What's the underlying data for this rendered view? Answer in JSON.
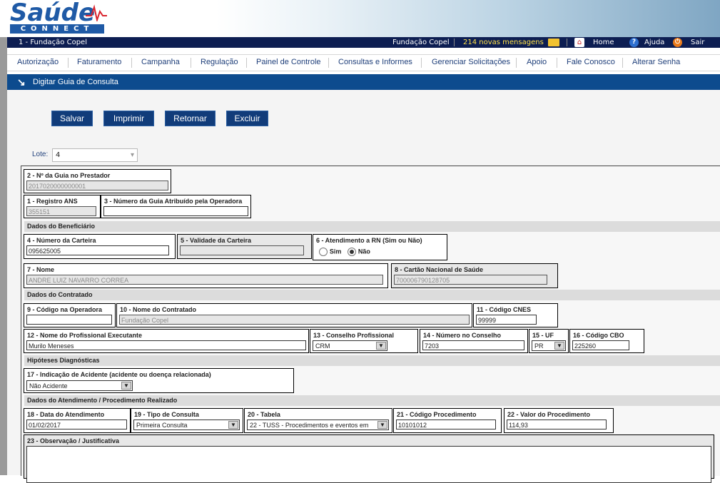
{
  "header": {
    "logo_main": "Saúde",
    "logo_sub": "CONNECT",
    "org_code": "1 - Fundação Copel",
    "org_name": "Fundação Copel",
    "messages": "214 novas mensagens",
    "home": "Home",
    "help": "Ajuda",
    "exit": "Sair"
  },
  "menu": [
    "Autorização",
    "Faturamento",
    "Campanha",
    "Regulação",
    "Painel de Controle",
    "Consultas e Informes",
    "Gerenciar Solicitações",
    "Apoio",
    "Fale Conosco",
    "Alterar Senha"
  ],
  "page_title": "Digitar Guia de Consulta",
  "actions": {
    "save": "Salvar",
    "print": "Imprimir",
    "back": "Retornar",
    "delete": "Excluir"
  },
  "lote": {
    "label": "Lote:",
    "value": "4"
  },
  "form": {
    "f2": {
      "label": "2 - Nº da Guia no Prestador",
      "value": "2017020000000001"
    },
    "f1": {
      "label": "1 - Registro ANS",
      "value": "355151"
    },
    "f3": {
      "label": "3 - Número da Guia Atribuído pela Operadora",
      "value": ""
    },
    "sec_beneficiario": "Dados do Beneficiário",
    "f4": {
      "label": "4 - Número da Carteira",
      "value": "095625005"
    },
    "f5": {
      "label": "5 - Validade da Carteira",
      "value": ""
    },
    "f6": {
      "label": "6 - Atendimento a RN (Sim ou Não)",
      "opt_yes": "Sim",
      "opt_no": "Não"
    },
    "f7": {
      "label": "7 - Nome",
      "value": "ANDRE LUIZ NAVARRO CORREA"
    },
    "f8": {
      "label": "8 - Cartão Nacional de Saúde",
      "value": "700006790128705"
    },
    "sec_contratado": "Dados do Contratado",
    "f9": {
      "label": "9 - Código na Operadora",
      "value": ""
    },
    "f10": {
      "label": "10 - Nome do Contratado",
      "value": "Fundação Copel"
    },
    "f11": {
      "label": "11 - Código CNES",
      "value": "99999"
    },
    "f12": {
      "label": "12 - Nome do Profissional Executante",
      "value": "Murilo Meneses"
    },
    "f13": {
      "label": "13 - Conselho Profissional",
      "value": "CRM"
    },
    "f14": {
      "label": "14 - Número no Conselho",
      "value": "7203"
    },
    "f15": {
      "label": "15 - UF",
      "value": "PR"
    },
    "f16": {
      "label": "16 - Código CBO",
      "value": "225260"
    },
    "sec_hipoteses": "Hipóteses Diagnósticas",
    "f17": {
      "label": "17 - Indicação de Acidente (acidente ou doença relacionada)",
      "value": "Não Acidente"
    },
    "sec_atendimento": "Dados do Atendimento / Procedimento Realizado",
    "f18": {
      "label": "18 - Data do Atendimento",
      "value": "01/02/2017"
    },
    "f19": {
      "label": "19 - Tipo de Consulta",
      "value": "Primeira Consulta"
    },
    "f20": {
      "label": "20 - Tabela",
      "value": "22 - TUSS - Procedimentos e eventos em"
    },
    "f21": {
      "label": "21 - Código Procedimento",
      "value": "10101012"
    },
    "f22": {
      "label": "22 - Valor do Procedimento",
      "value": "114,93"
    },
    "f23": {
      "label": "23 - Observação / Justificativa",
      "value": ""
    }
  }
}
